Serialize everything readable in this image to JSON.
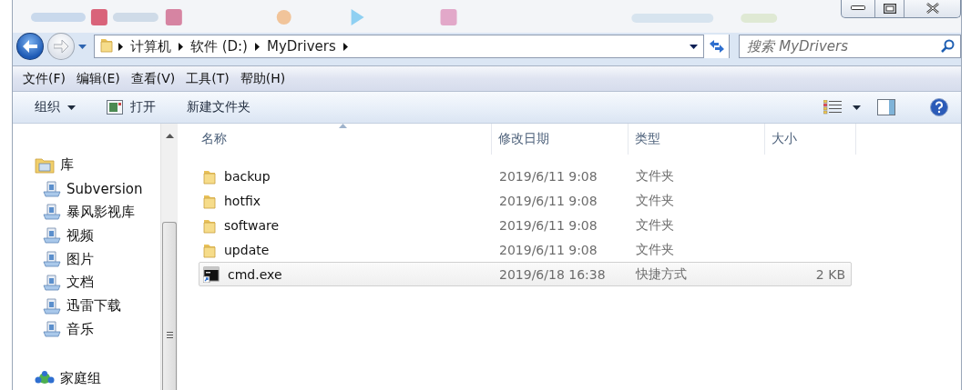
{
  "address_bar": {
    "crumbs": [
      "计算机",
      "软件 (D:)",
      "MyDrivers"
    ]
  },
  "search": {
    "placeholder": "搜索 MyDrivers"
  },
  "menu_bar": [
    "文件(F)",
    "编辑(E)",
    "查看(V)",
    "工具(T)",
    "帮助(H)"
  ],
  "toolbar": {
    "items": [
      {
        "kind": "menu",
        "label": "组织"
      },
      {
        "kind": "open",
        "label": "打开"
      },
      {
        "kind": "plain",
        "label": "新建文件夹"
      }
    ]
  },
  "sidebar": {
    "items": [
      {
        "kind": "library",
        "label": "库",
        "children": [
          {
            "label": "Subversion"
          },
          {
            "label": "暴风影视库"
          },
          {
            "label": "视频"
          },
          {
            "label": "图片"
          },
          {
            "label": "文档"
          },
          {
            "label": "迅雷下载"
          },
          {
            "label": "音乐"
          }
        ]
      },
      {
        "kind": "homegroup",
        "label": "家庭组"
      }
    ]
  },
  "table": {
    "columns": [
      "名称",
      "修改日期",
      "类型",
      "大小"
    ],
    "rows": [
      {
        "kind": "folder",
        "name": "backup",
        "modified": "2019/6/11 9:08",
        "type": "文件夹",
        "selected": false
      },
      {
        "kind": "folder",
        "name": "hotfix",
        "modified": "2019/6/11 9:08",
        "type": "文件夹",
        "selected": false
      },
      {
        "kind": "folder",
        "name": "software",
        "modified": "2019/6/11 9:08",
        "type": "文件夹",
        "selected": false
      },
      {
        "kind": "folder",
        "name": "update",
        "modified": "2019/6/11 9:08",
        "type": "文件夹",
        "selected": false
      },
      {
        "kind": "shortcut",
        "name": "cmd.exe",
        "modified": "2019/6/18 16:38",
        "type": "快捷方式",
        "size": "2 KB",
        "selected": true
      }
    ]
  }
}
